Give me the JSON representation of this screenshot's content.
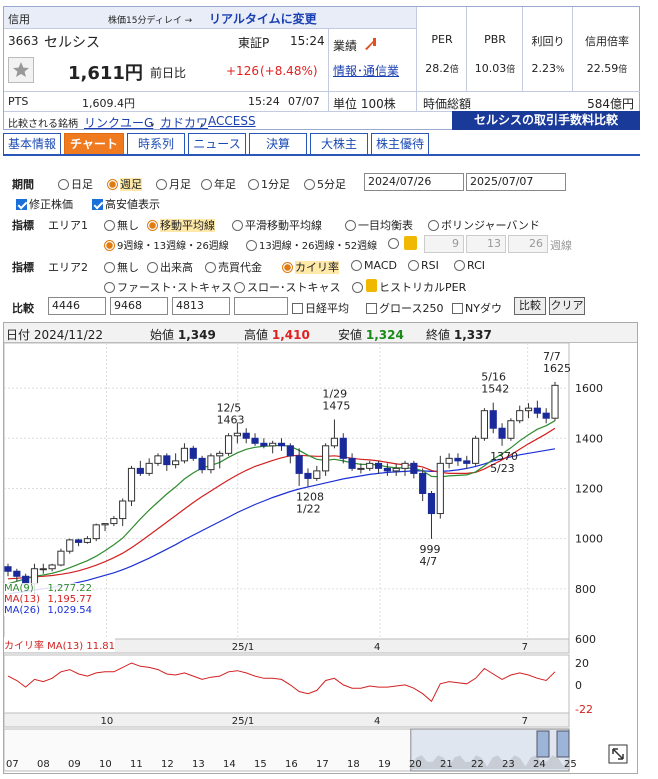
{
  "header": {
    "category": "信用",
    "delay_note": "株価15分ディレイ →",
    "realtime_link": "リアルタイムに変更",
    "code": "3663",
    "name": "セルシス",
    "market": "東証P",
    "time": "15:24",
    "gyoseki_label": "業績",
    "industry": "情報･通信業",
    "price": "1,611円",
    "change_label": "前日比",
    "change": "+126",
    "change_pct": "(+8.48%)",
    "pts_label": "PTS",
    "pts_price": "1,609.4円",
    "pts_time": "15:24",
    "pts_date": "07/07",
    "unit": "単位 100株",
    "metrics": [
      {
        "label": "PER",
        "value": "28.2",
        "unit": "倍"
      },
      {
        "label": "PBR",
        "value": "10.03",
        "unit": "倍"
      },
      {
        "label": "利回り",
        "value": "2.23",
        "unit": "%"
      },
      {
        "label": "信用倍率",
        "value": "22.59",
        "unit": "倍"
      }
    ],
    "mcap_label": "時価総額",
    "mcap_value": "584億円",
    "compare_label": "比較される銘柄",
    "compare_links": [
      "リンクユーG",
      "カドカワ",
      "ACCESS"
    ],
    "fee_banner": "セルシスの取引手数料比較"
  },
  "tabs": [
    "基本情報",
    "チャート",
    "時系列",
    "ニュース",
    "決算",
    "大株主",
    "株主優待"
  ],
  "active_tab": 1,
  "period": {
    "label": "期間",
    "options": [
      "日足",
      "週足",
      "月足",
      "年足",
      "1分足",
      "5分足"
    ],
    "selected": 1,
    "from": "2024/07/26",
    "to": "2025/07/07",
    "adjusted": "修正株価",
    "highlow": "高安値表示"
  },
  "indicator1": {
    "label": "指標",
    "area": "エリア1",
    "options": [
      "無し",
      "移動平均線",
      "平滑移動平均線",
      "一目均衡表",
      "ボリンジャーバンド"
    ],
    "selected": 1,
    "ma_options": [
      "9週線・13週線・26週線",
      "13週線・26週線・52週線"
    ],
    "ma_selected": 0,
    "custom": [
      "9",
      "13",
      "26"
    ],
    "custom_unit": "週線"
  },
  "indicator2": {
    "label": "指標",
    "area": "エリア2",
    "options": [
      "無し",
      "出来高",
      "売買代金",
      "カイリ率",
      "MACD",
      "RSI",
      "RCI"
    ],
    "selected": 3,
    "options2": [
      "ファースト･ストキャス",
      "スロー･ストキャス",
      "ヒストリカルPER"
    ]
  },
  "compare": {
    "label": "比較",
    "codes": [
      "4446",
      "9468",
      "4813",
      ""
    ],
    "nikkei": "日経平均",
    "growth": "グロース250",
    "nydow": "NYダウ",
    "compare_btn": "比較",
    "clear_btn": "クリア"
  },
  "ohlc": {
    "date_label": "日付",
    "date": "2024/11/22",
    "open_label": "始値",
    "open": "1,349",
    "high_label": "高値",
    "high": "1,410",
    "low_label": "安値",
    "low": "1,324",
    "close_label": "終値",
    "close": "1,337"
  },
  "legend": [
    {
      "label": "MA(9)",
      "value": "1,277.22",
      "color": "#2e8b2e"
    },
    {
      "label": "MA(13)",
      "value": "1,195.77",
      "color": "#d22020"
    },
    {
      "label": "MA(26)",
      "value": "1,029.54",
      "color": "#1c2fd6"
    }
  ],
  "kairi_label": "カイリ率  MA(13)",
  "kairi_value": "11.81",
  "colors": {
    "up": "#ffffff",
    "down": "#1a2a9a",
    "ma9": "#2e8b2e",
    "ma13": "#d22020",
    "ma26": "#1c2fd6",
    "kairi": "#d22020",
    "tab_active": "#f07a1f",
    "link": "#1a3fb0"
  },
  "chart_data": {
    "type": "candlestick",
    "ylim": [
      600,
      1700
    ],
    "yticks": [
      "1600",
      "1400",
      "1200",
      "1000",
      "800",
      "600"
    ],
    "x_labels": [
      "10",
      "25/1",
      "4",
      "7"
    ],
    "nav_labels": [
      "07",
      "08",
      "09",
      "10",
      "11",
      "12",
      "13",
      "14",
      "15",
      "16",
      "17",
      "18",
      "19",
      "20",
      "21",
      "22",
      "23",
      "24",
      "25"
    ],
    "kairi_ticks": [
      "20",
      "0",
      "-22"
    ],
    "annotations": [
      {
        "text": "12/5",
        "value": "1463"
      },
      {
        "text": "1/29",
        "value": "1475"
      },
      {
        "text": "5/16",
        "value": "1542"
      },
      {
        "text": "7/7",
        "value": "1625"
      },
      {
        "text": "1208",
        "value": "1/22"
      },
      {
        "text": "1370",
        "value": "5/23"
      },
      {
        "text": "999",
        "value": "4/7"
      }
    ],
    "candles": [
      [
        888,
        900,
        850,
        870
      ],
      [
        870,
        880,
        830,
        850
      ],
      [
        850,
        860,
        800,
        820
      ],
      [
        820,
        900,
        760,
        880
      ],
      [
        880,
        900,
        860,
        880
      ],
      [
        880,
        900,
        870,
        895
      ],
      [
        895,
        960,
        890,
        950
      ],
      [
        950,
        1000,
        940,
        995
      ],
      [
        995,
        1000,
        970,
        985
      ],
      [
        985,
        1010,
        980,
        1000
      ],
      [
        1000,
        1060,
        990,
        1055
      ],
      [
        1055,
        1060,
        1030,
        1060
      ],
      [
        1060,
        1090,
        1050,
        1080
      ],
      [
        1080,
        1160,
        1050,
        1150
      ],
      [
        1150,
        1290,
        1130,
        1280
      ],
      [
        1280,
        1310,
        1250,
        1260
      ],
      [
        1260,
        1320,
        1250,
        1300
      ],
      [
        1300,
        1340,
        1290,
        1330
      ],
      [
        1330,
        1340,
        1270,
        1295
      ],
      [
        1295,
        1340,
        1280,
        1310
      ],
      [
        1310,
        1380,
        1300,
        1360
      ],
      [
        1360,
        1370,
        1310,
        1320
      ],
      [
        1320,
        1330,
        1260,
        1275
      ],
      [
        1275,
        1340,
        1260,
        1330
      ],
      [
        1330,
        1350,
        1280,
        1340
      ],
      [
        1340,
        1420,
        1330,
        1410
      ],
      [
        1410,
        1463,
        1380,
        1420
      ],
      [
        1420,
        1440,
        1380,
        1400
      ],
      [
        1400,
        1420,
        1370,
        1380
      ],
      [
        1380,
        1400,
        1360,
        1370
      ],
      [
        1370,
        1390,
        1340,
        1380
      ],
      [
        1380,
        1400,
        1350,
        1370
      ],
      [
        1370,
        1380,
        1300,
        1330
      ],
      [
        1330,
        1360,
        1210,
        1260
      ],
      [
        1260,
        1280,
        1208,
        1240
      ],
      [
        1240,
        1290,
        1230,
        1270
      ],
      [
        1270,
        1380,
        1250,
        1370
      ],
      [
        1370,
        1475,
        1360,
        1400
      ],
      [
        1400,
        1420,
        1300,
        1320
      ],
      [
        1320,
        1340,
        1270,
        1280
      ],
      [
        1280,
        1300,
        1260,
        1280
      ],
      [
        1280,
        1310,
        1270,
        1300
      ],
      [
        1300,
        1310,
        1260,
        1280
      ],
      [
        1280,
        1300,
        1250,
        1270
      ],
      [
        1270,
        1300,
        1250,
        1280
      ],
      [
        1280,
        1310,
        1250,
        1300
      ],
      [
        1300,
        1310,
        1240,
        1260
      ],
      [
        1260,
        1280,
        1150,
        1180
      ],
      [
        1180,
        1190,
        999,
        1100
      ],
      [
        1100,
        1330,
        1080,
        1300
      ],
      [
        1300,
        1340,
        1280,
        1320
      ],
      [
        1320,
        1340,
        1290,
        1310
      ],
      [
        1310,
        1330,
        1280,
        1300
      ],
      [
        1300,
        1410,
        1290,
        1400
      ],
      [
        1400,
        1520,
        1390,
        1510
      ],
      [
        1510,
        1542,
        1420,
        1440
      ],
      [
        1440,
        1460,
        1370,
        1400
      ],
      [
        1400,
        1480,
        1390,
        1470
      ],
      [
        1470,
        1530,
        1460,
        1510
      ],
      [
        1510,
        1540,
        1480,
        1520
      ],
      [
        1520,
        1550,
        1480,
        1500
      ],
      [
        1500,
        1520,
        1460,
        1480
      ],
      [
        1480,
        1625,
        1470,
        1611
      ]
    ],
    "ma9": [
      820,
      830,
      840,
      850,
      855,
      862,
      872,
      884,
      898,
      912,
      930,
      952,
      976,
      1002,
      1040,
      1078,
      1114,
      1146,
      1178,
      1206,
      1238,
      1262,
      1282,
      1292,
      1304,
      1324,
      1342,
      1356,
      1364,
      1368,
      1370,
      1372,
      1368,
      1352,
      1332,
      1316,
      1312,
      1316,
      1310,
      1302,
      1296,
      1296,
      1294,
      1286,
      1282,
      1282,
      1280,
      1270,
      1248,
      1246,
      1250,
      1252,
      1254,
      1266,
      1290,
      1316,
      1338,
      1362,
      1390,
      1414,
      1436,
      1450,
      1470
    ],
    "ma13": [
      840,
      842,
      845,
      848,
      850,
      853,
      858,
      864,
      872,
      882,
      894,
      908,
      924,
      942,
      964,
      988,
      1014,
      1040,
      1066,
      1092,
      1118,
      1144,
      1168,
      1190,
      1212,
      1234,
      1254,
      1272,
      1288,
      1300,
      1312,
      1322,
      1330,
      1332,
      1330,
      1328,
      1328,
      1330,
      1326,
      1320,
      1316,
      1314,
      1310,
      1304,
      1298,
      1294,
      1292,
      1286,
      1272,
      1264,
      1260,
      1260,
      1260,
      1264,
      1278,
      1296,
      1314,
      1334,
      1356,
      1378,
      1398,
      1418,
      1440
    ],
    "ma26": [
      780,
      785,
      790,
      795,
      800,
      806,
      812,
      818,
      826,
      834,
      844,
      854,
      864,
      876,
      890,
      906,
      922,
      940,
      958,
      976,
      996,
      1014,
      1032,
      1050,
      1068,
      1086,
      1104,
      1120,
      1136,
      1150,
      1164,
      1176,
      1188,
      1198,
      1206,
      1214,
      1222,
      1230,
      1238,
      1244,
      1250,
      1256,
      1260,
      1264,
      1266,
      1268,
      1270,
      1270,
      1268,
      1268,
      1270,
      1274,
      1280,
      1288,
      1298,
      1310,
      1318,
      1326,
      1334,
      1340,
      1346,
      1352,
      1358
    ],
    "kairi": [
      8,
      4,
      -2,
      5,
      3,
      6,
      12,
      14,
      10,
      8,
      11,
      12,
      12,
      16,
      20,
      17,
      16,
      14,
      10,
      9,
      11,
      8,
      5,
      7,
      8,
      12,
      13,
      11,
      8,
      6,
      6,
      5,
      0,
      -6,
      -8,
      -5,
      4,
      6,
      0,
      -3,
      -3,
      -1,
      -2,
      -2,
      -1,
      0,
      -3,
      -8,
      -15,
      1,
      3,
      2,
      1,
      6,
      15,
      10,
      5,
      9,
      11,
      9,
      6,
      4,
      12
    ]
  }
}
